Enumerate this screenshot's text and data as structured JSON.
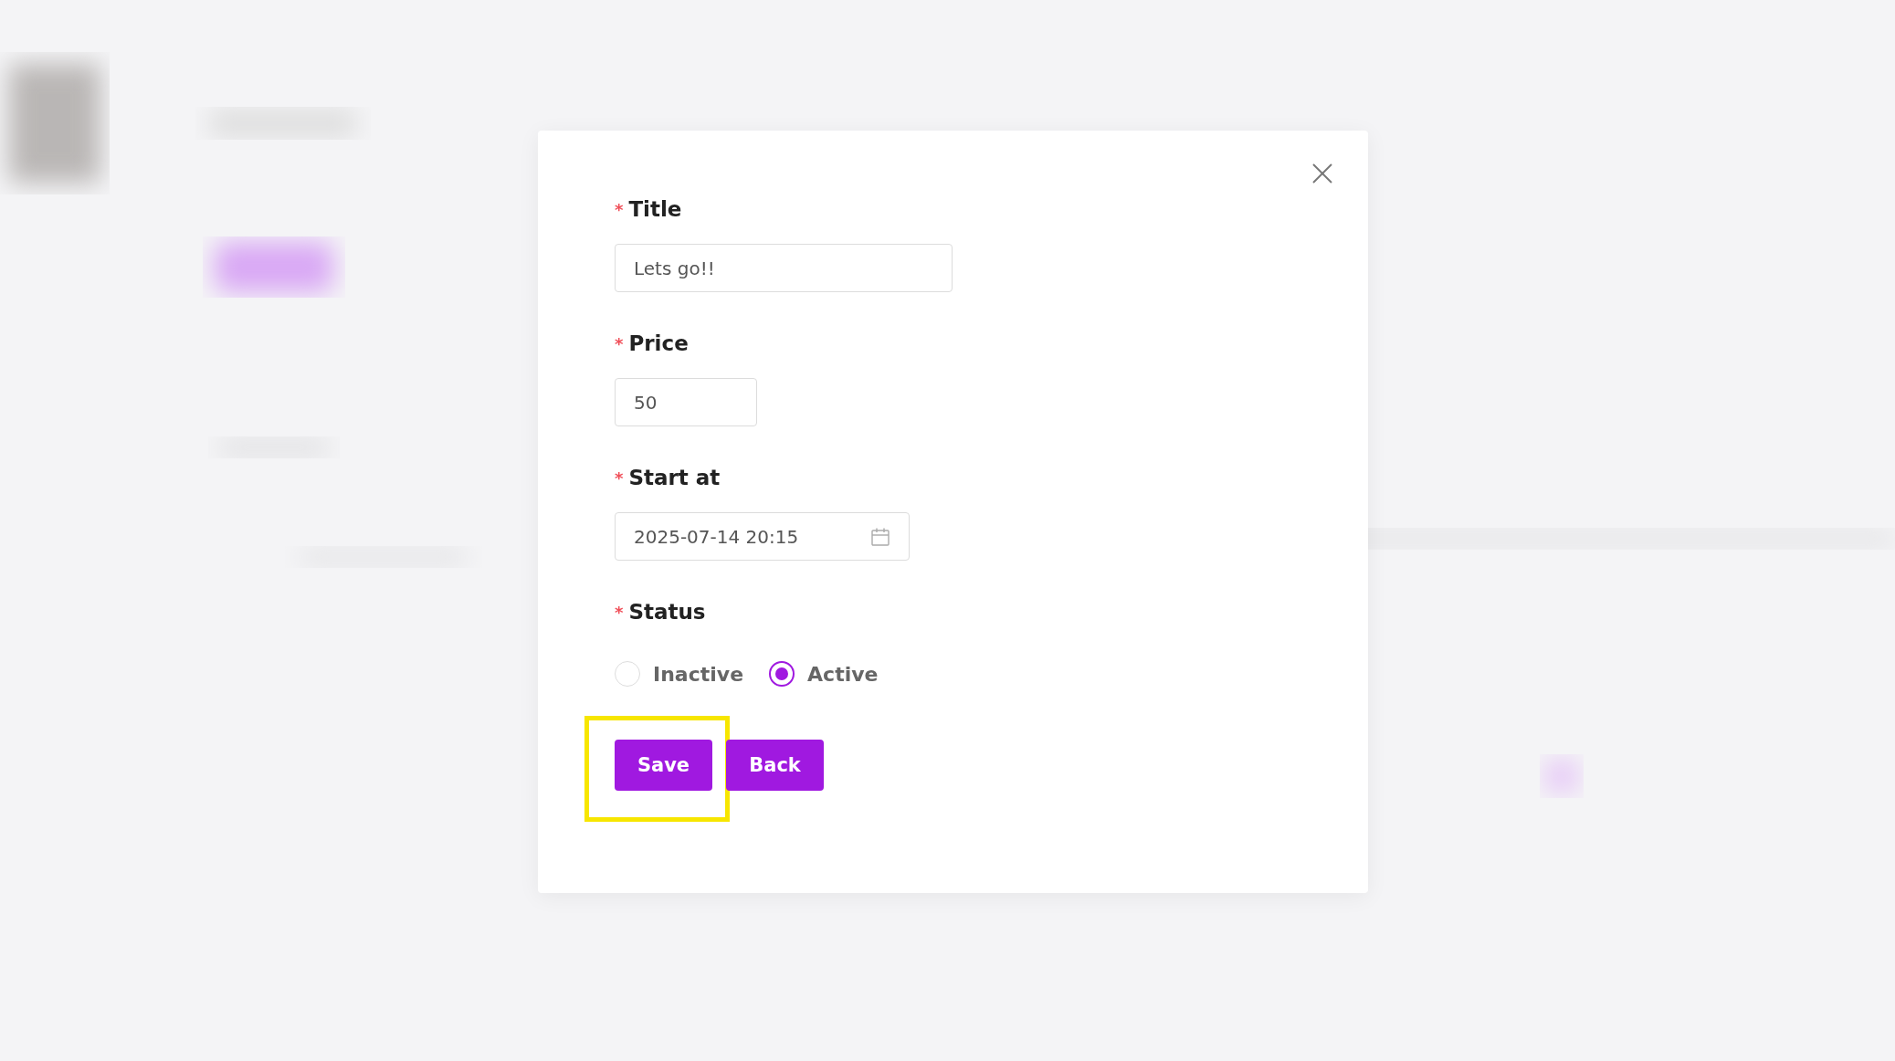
{
  "modal": {
    "fields": [
      {
        "kind": "text",
        "required_mark": "*",
        "label": "Title",
        "value": "Lets go!!"
      },
      {
        "kind": "number",
        "required_mark": "*",
        "label": "Price",
        "value": "50"
      },
      {
        "kind": "datetime",
        "required_mark": "*",
        "label": "Start at",
        "value": "2025-07-14 20:15"
      },
      {
        "kind": "radio",
        "required_mark": "*",
        "label": "Status",
        "options": [
          {
            "label": "Inactive",
            "selected": false
          },
          {
            "label": "Active",
            "selected": true
          }
        ]
      }
    ],
    "buttons": [
      {
        "label": "Save",
        "highlighted": true
      },
      {
        "label": "Back",
        "highlighted": false
      }
    ]
  }
}
